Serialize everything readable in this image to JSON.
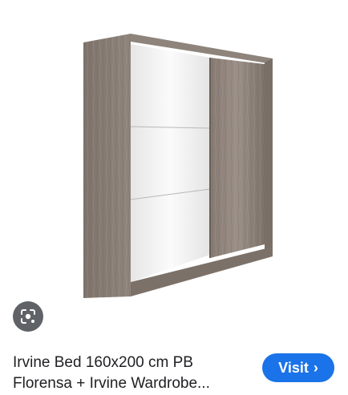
{
  "result": {
    "title_line1": "Irvine Bed 160x200 cm PB",
    "title_line2": "Florensa + Irvine Wardrobe...",
    "visit_label": "Visit",
    "visit_chevron": "›"
  },
  "icons": {
    "lens": "google-lens-icon",
    "chevron": "chevron-right-icon"
  },
  "colors": {
    "accent": "#1a73e8",
    "lens_bg": "#5f6368",
    "text": "#202124",
    "wood": "#8b7f75"
  }
}
